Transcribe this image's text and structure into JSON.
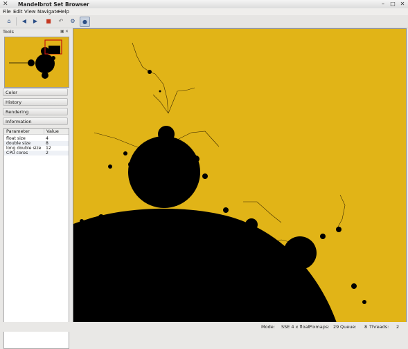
{
  "window": {
    "title": "Mandelbrot Set Browser",
    "app_icon": "x-app-icon",
    "controls": [
      "minimize-icon",
      "maximize-icon",
      "close-icon"
    ]
  },
  "menu": {
    "items": [
      "File",
      "Edit",
      "View",
      "Navigate",
      "Help"
    ]
  },
  "toolbar": {
    "icons": [
      "home-icon",
      "back-icon",
      "forward-icon",
      "palette-icon",
      "undo-icon",
      "settings-icon",
      "about-icon"
    ]
  },
  "sidebar": {
    "dock_title": "Tools",
    "sections": [
      "Color",
      "History",
      "Rendering",
      "Information"
    ],
    "table": {
      "headers": [
        "Parameter",
        "Value"
      ],
      "rows": [
        {
          "parameter": "float size",
          "value": "4"
        },
        {
          "parameter": "double size",
          "value": "8"
        },
        {
          "parameter": "long double size",
          "value": "12"
        },
        {
          "parameter": "CPU cores",
          "value": "2"
        }
      ]
    }
  },
  "colors": {
    "fractal_background": "#e1b417",
    "fractal_set": "#000000"
  },
  "status": {
    "mode_label": "Mode:",
    "mode_value": "SSE 4 x float",
    "pixmaps_label": "Pixmaps:",
    "pixmaps_value": "29",
    "queue_label": "Queue:",
    "queue_value": "8",
    "threads_label": "Threads:",
    "threads_value": "2"
  }
}
